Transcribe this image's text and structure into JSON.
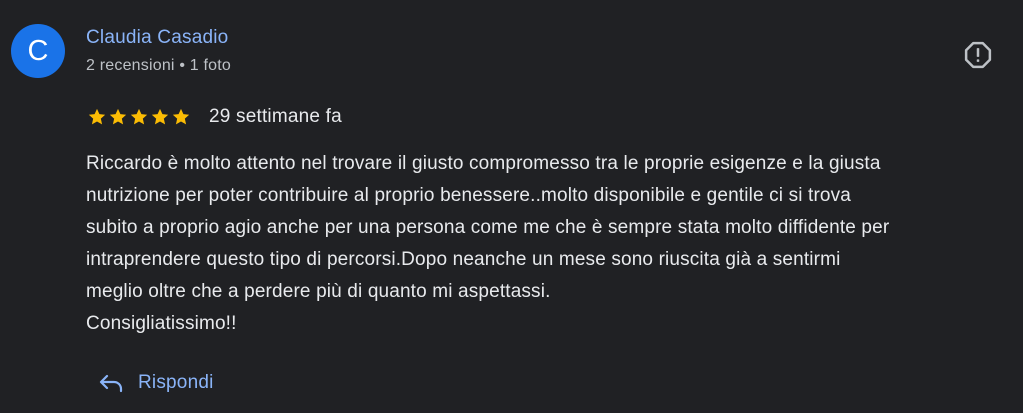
{
  "review": {
    "avatar_letter": "C",
    "author_name": "Claudia Casadio",
    "author_meta": "2 recensioni • 1 foto",
    "rating": 5,
    "rating_max": 5,
    "time_ago": "29 settimane fa",
    "text": "Riccardo è molto attento nel trovare il giusto compromesso tra le proprie esigenze e la giusta\nnutrizione per poter contribuire al proprio benessere..molto disponibile e gentile ci si trova\nsubito a proprio agio anche per una persona come me che è sempre stata molto diffidente per\nintraprendere questo tipo di percorsi.Dopo neanche un mese sono riuscita già a sentirmi\nmeglio oltre che a perdere più di quanto mi aspettassi.\nConsigliatissimo!!",
    "reply_label": "Rispondi"
  },
  "icons": {
    "report": "report-icon",
    "star": "star-icon",
    "reply": "reply-icon"
  },
  "colors": {
    "background": "#202124",
    "avatar_bg": "#1a73e8",
    "link_blue": "#8ab4f8",
    "star_gold": "#fbbc04",
    "primary_text": "#e8eaed",
    "secondary_text": "#bdc1c6",
    "icon_gray": "#bdc1c6"
  }
}
